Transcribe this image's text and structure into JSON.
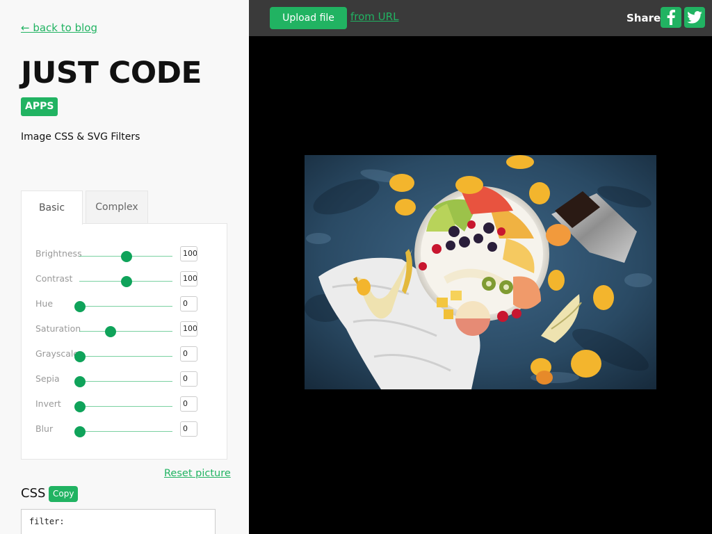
{
  "sidebar": {
    "back_link": "← back to blog",
    "logo": "JUST CODE",
    "badge": "APPS",
    "subtitle": "Image CSS & SVG Filters",
    "tabs": [
      "Basic",
      "Complex"
    ],
    "filters": [
      {
        "label": "Brightness",
        "value": "100",
        "level": 0.5
      },
      {
        "label": "Contrast",
        "value": "100",
        "level": 0.5
      },
      {
        "label": "Hue",
        "value": "0",
        "level": 0
      },
      {
        "label": "Saturation",
        "value": "100",
        "level": 0.33
      },
      {
        "label": "Grayscale",
        "value": "0",
        "level": 0
      },
      {
        "label": "Sepia",
        "value": "0",
        "level": 0
      },
      {
        "label": "Invert",
        "value": "0",
        "level": 0
      },
      {
        "label": "Blur",
        "value": "0",
        "level": 0
      }
    ],
    "reset_link": "Reset picture",
    "css_label": "CSS",
    "copy_button": "Copy",
    "css_output": "filter:"
  },
  "topbar": {
    "upload_button": "Upload file",
    "url_link": "from URL",
    "share_label": "Share:",
    "share_icons": [
      "facebook-icon",
      "twitter-icon"
    ]
  },
  "colors": {
    "accent": "#21b362",
    "sidebar_bg": "#f8f8f8",
    "topbar_bg": "#3a3a3a",
    "stage_bg": "#000000"
  }
}
